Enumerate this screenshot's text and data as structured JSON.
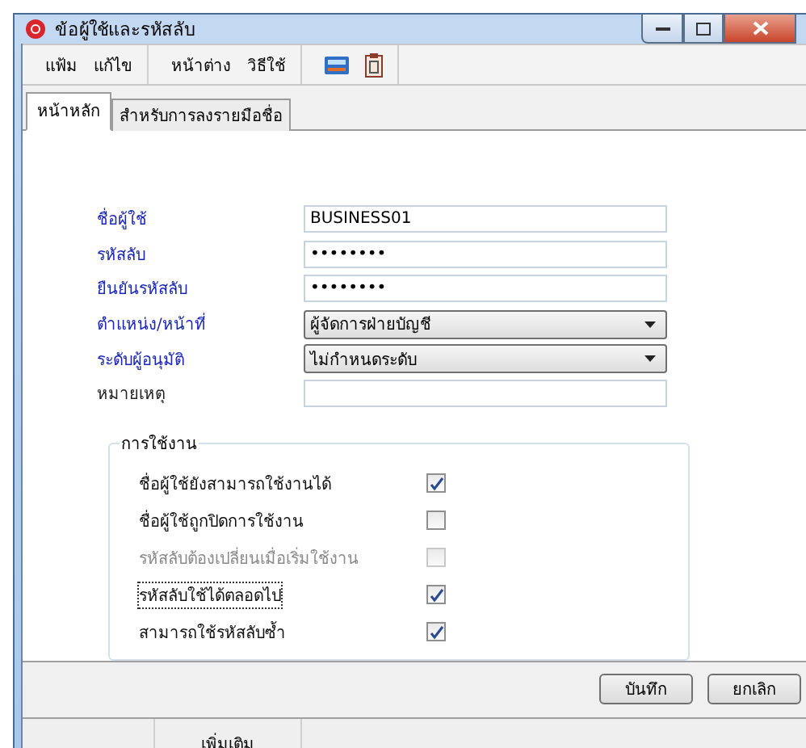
{
  "window": {
    "title": "ข้อผู้ใช้และรหัสลับ"
  },
  "toolbar": {
    "groups": [
      [
        "แฟ้ม",
        "แก้ไข"
      ],
      [
        "หน้าต่าง",
        "วิธีใช้"
      ]
    ]
  },
  "tabs": [
    {
      "label": "หน้าหลัก",
      "selected": true
    },
    {
      "label": "สำหรับการลงรายมือชื่อ",
      "selected": false
    }
  ],
  "fields": [
    {
      "label": "ชื่อผู้ใช้",
      "required": true,
      "kind": "text",
      "value": "BUSINESS01"
    },
    {
      "label": "รหัสลับ",
      "required": true,
      "kind": "text",
      "value": "••••••••"
    },
    {
      "label": "ยืนยันรหัสลับ",
      "required": true,
      "kind": "text",
      "value": "••••••••"
    },
    {
      "label": "ตำแหน่ง/หน้าที่",
      "required": true,
      "kind": "select",
      "value": "ผู้จัดการฝ่ายบัญชี"
    },
    {
      "label": "ระดับผู้อนุมัติ",
      "required": true,
      "kind": "select",
      "value": "ไม่กำหนดระดับ"
    },
    {
      "label": "หมายเหตุ",
      "required": false,
      "kind": "text"
    }
  ],
  "usage": {
    "title": "การใช้งาน",
    "options": [
      {
        "label": "ชื่อผู้ใช้ยังสามารถใช้งานได้",
        "checked": true,
        "disabled": false,
        "focused": false
      },
      {
        "label": "ชื่อผู้ใช้ถูกปิดการใช้งาน",
        "checked": false,
        "disabled": false,
        "focused": false
      },
      {
        "label": "รหัสลับต้องเปลี่ยนเมื่อเริ่มใช้งาน",
        "checked": false,
        "disabled": true,
        "focused": false
      },
      {
        "label": "รหัสลับใช้ได้ตลอดไป",
        "checked": true,
        "disabled": false,
        "focused": true
      },
      {
        "label": "สามารถใช้รหัสลับซ้ำ",
        "checked": true,
        "disabled": false,
        "focused": false
      }
    ]
  },
  "buttons": [
    "บันทึก",
    "ยกเลิก"
  ],
  "bottom_table": {
    "columns": [
      "เพิ่มเติม"
    ]
  }
}
